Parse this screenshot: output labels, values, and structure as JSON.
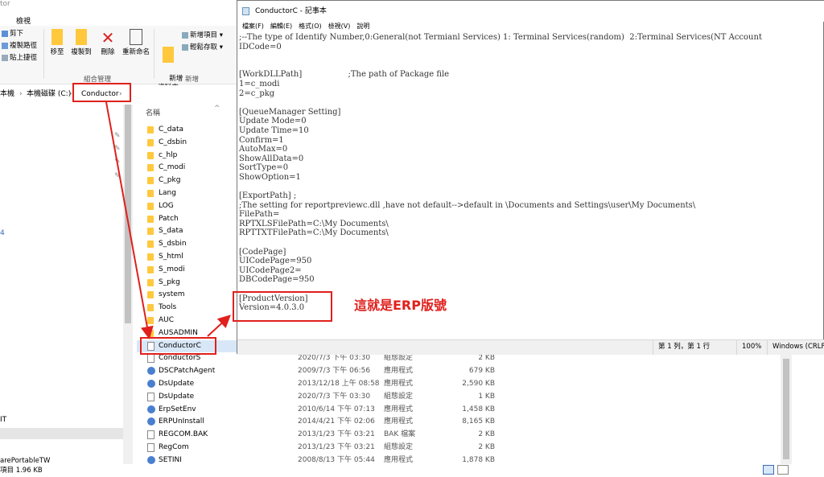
{
  "explorer": {
    "title_fragment": "tor",
    "ribbon_tab": "檢視",
    "clipboard": {
      "cut": "剪下",
      "copy_path": "複製路徑",
      "paste_shortcut": "貼上捷徑"
    },
    "organize": {
      "move_to": "移至",
      "copy_to": "複製到",
      "delete": "刪除",
      "rename": "重新命名",
      "group_label": "組合管理"
    },
    "new_group": {
      "new_folder": "新增\n資料夾",
      "new_item": "新增項目 ▾",
      "easy_access": "輕鬆存取 ▾",
      "group_label": "新增"
    },
    "breadcrumb": [
      "本機",
      "本機磁碟 (C:)",
      "Conductor"
    ],
    "column_name": "名稱",
    "files": [
      {
        "name": "C_data",
        "kind": "folder"
      },
      {
        "name": "C_dsbin",
        "kind": "folder"
      },
      {
        "name": "c_hlp",
        "kind": "folder"
      },
      {
        "name": "C_modi",
        "kind": "folder"
      },
      {
        "name": "C_pkg",
        "kind": "folder"
      },
      {
        "name": "Lang",
        "kind": "folder"
      },
      {
        "name": "LOG",
        "kind": "folder"
      },
      {
        "name": "Patch",
        "kind": "folder"
      },
      {
        "name": "S_data",
        "kind": "folder"
      },
      {
        "name": "S_dsbin",
        "kind": "folder"
      },
      {
        "name": "S_html",
        "kind": "folder"
      },
      {
        "name": "S_modi",
        "kind": "folder"
      },
      {
        "name": "S_pkg",
        "kind": "folder"
      },
      {
        "name": "system",
        "kind": "folder"
      },
      {
        "name": "Tools",
        "kind": "folder"
      },
      {
        "name": "AUC",
        "kind": "folder"
      },
      {
        "name": "AUSADMIN",
        "kind": "folder"
      },
      {
        "name": "ConductorC",
        "kind": "file",
        "date": "",
        "type": "",
        "size": ""
      },
      {
        "name": "ConductorS",
        "kind": "file",
        "date": "2020/7/3 下午 03:30",
        "type": "組態設定",
        "size": "2 KB"
      },
      {
        "name": "DSCPatchAgent",
        "kind": "exe",
        "date": "2009/7/3 下午 06:56",
        "type": "應用程式",
        "size": "679 KB"
      },
      {
        "name": "DsUpdate",
        "kind": "exe",
        "date": "2013/12/18 上午 08:58",
        "type": "應用程式",
        "size": "2,590 KB"
      },
      {
        "name": "DsUpdate",
        "kind": "file",
        "date": "2020/7/3 下午 03:30",
        "type": "組態設定",
        "size": "1 KB"
      },
      {
        "name": "ErpSetEnv",
        "kind": "exe",
        "date": "2010/6/14 下午 07:13",
        "type": "應用程式",
        "size": "1,458 KB"
      },
      {
        "name": "ERPUnInstall",
        "kind": "exe",
        "date": "2014/4/21 下午 02:06",
        "type": "應用程式",
        "size": "8,165 KB"
      },
      {
        "name": "REGCOM.BAK",
        "kind": "file",
        "date": "2013/1/23 下午 03:21",
        "type": "BAK 檔案",
        "size": "2 KB"
      },
      {
        "name": "RegCom",
        "kind": "file",
        "date": "2013/1/23 下午 03:21",
        "type": "組態設定",
        "size": "2 KB"
      },
      {
        "name": "SETINI",
        "kind": "exe",
        "date": "2008/8/13 下午 05:44",
        "type": "應用程式",
        "size": "1,878 KB"
      }
    ],
    "nav_fragment_1": "4",
    "nav_fragment_2": "IT",
    "status_line1": "arePortableTW",
    "status_line2": "項目  1.96 KB"
  },
  "notepad": {
    "title": "ConductorC - 記事本",
    "menu": [
      "檔案(F)",
      "編輯(E)",
      "格式(O)",
      "檢視(V)",
      "說明"
    ],
    "content": ";--The type of Identify Number,0:General(not Termianl Services) 1: Terminal Services(random)  2:Terminal Services(NT Account\nIDCode=0\n\n\n[WorkDLLPath]                  ;The path of Package file\n1=c_modi\n2=c_pkg\n\n[QueueManager Setting]\nUpdate Mode=0\nUpdate Time=10\nConfirm=1\nAutoMax=0\nShowAllData=0\nSortType=0\nShowOption=1\n\n[ExportPath] ;\n;The setting for reportpreviewc.dll ,have not default-->default in \\Documents and Settings\\user\\My Documents\\\nFilePath=\nRPTXLSFilePath=C:\\My Documents\\\nRPTTXTFilePath=C:\\My Documents\\\n\n[CodePage]\nUICodePage=950\nUICodePage2=\nDBCodePage=950\n\n[ProductVersion]\nVersion=4.0.3.0",
    "status_pos": "第 1 列，第 1 行",
    "status_zoom": "100%",
    "status_eol": "Windows (CRLF"
  },
  "annotation": "這就是ERP版號",
  "colors": {
    "highlight": "#e0201c",
    "folder": "#ffc83d"
  }
}
